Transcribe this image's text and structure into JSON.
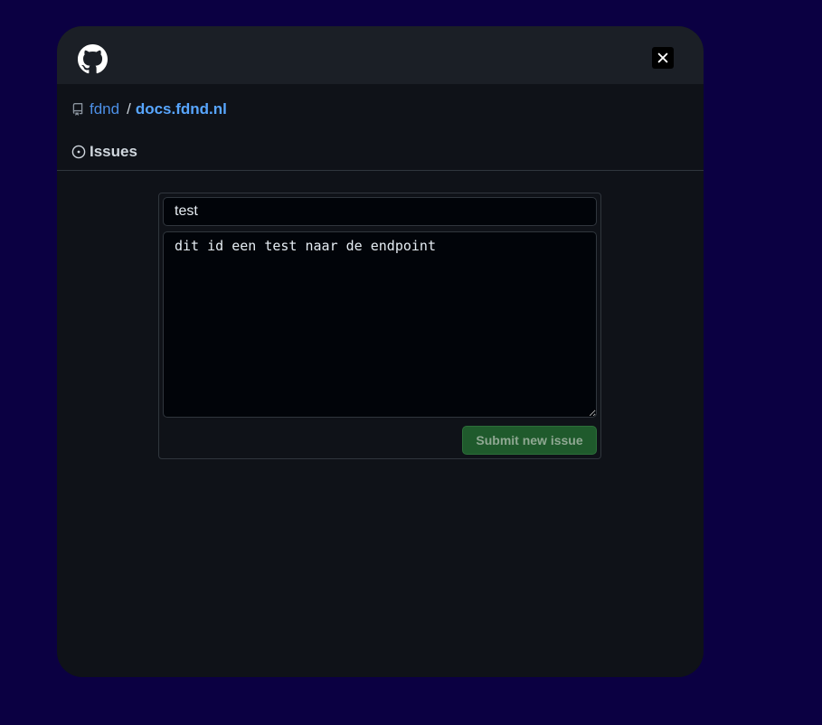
{
  "header": {
    "logo_icon": "github-icon",
    "close_icon": "close-icon"
  },
  "breadcrumb": {
    "repo_icon": "repo-icon",
    "owner": "fdnd",
    "separator": "/",
    "repo": "docs.fdnd.nl"
  },
  "section": {
    "icon": "issue-opened-icon",
    "title": "Issues"
  },
  "form": {
    "title_value": "test",
    "body_value": "dit id een test naar de endpoint",
    "submit_label": "Submit new issue"
  },
  "colors": {
    "page_background": "#0b0042",
    "widget_background": "#0f1218",
    "header_background": "#1b1f26",
    "link": "#58a6ff",
    "submit_button": "#1f5a2c"
  }
}
